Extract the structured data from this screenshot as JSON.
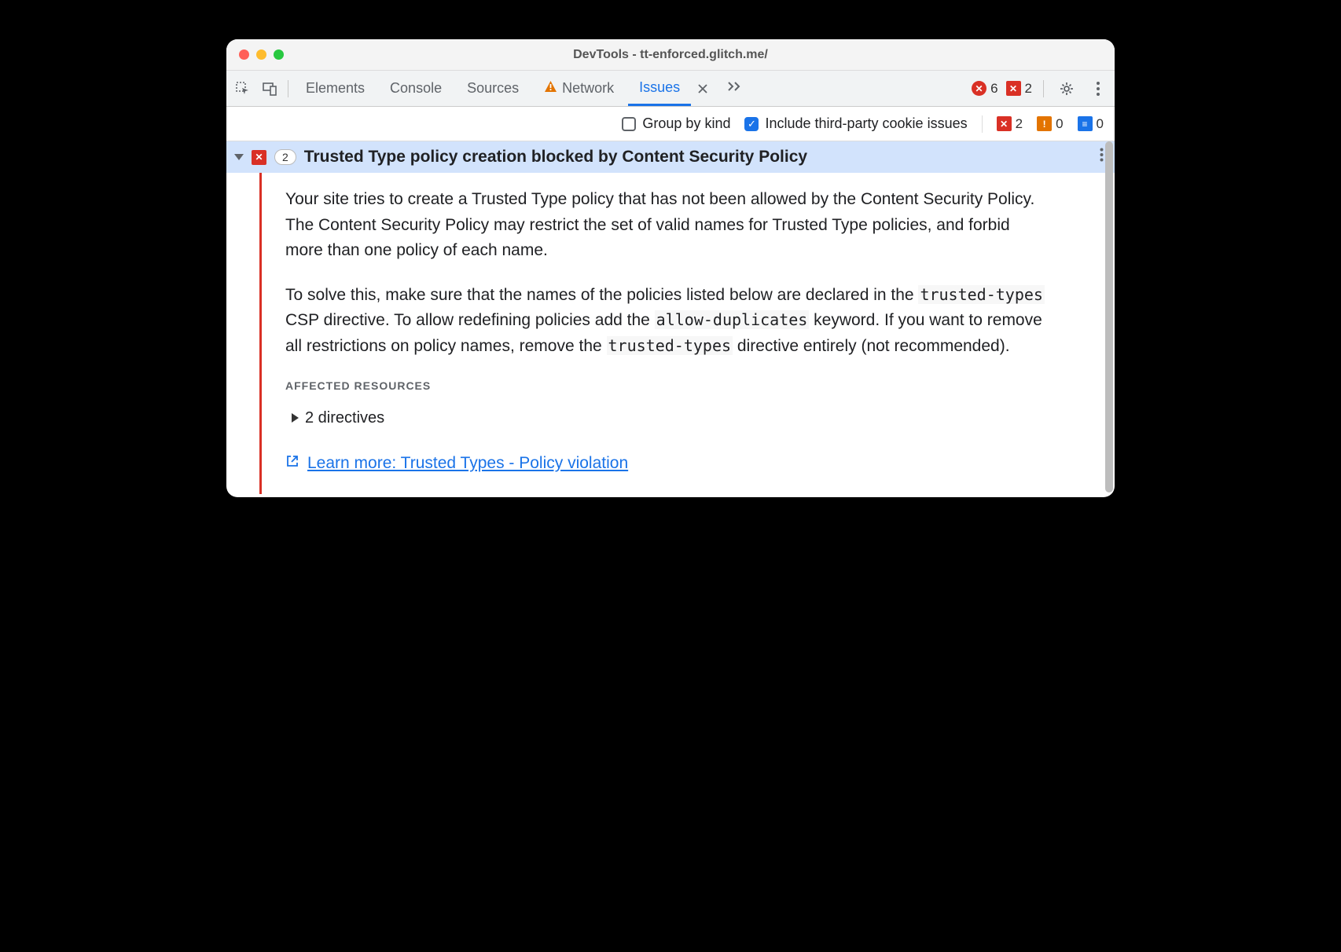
{
  "window": {
    "title": "DevTools - tt-enforced.glitch.me/"
  },
  "tabs": {
    "elements": "Elements",
    "console": "Console",
    "sources": "Sources",
    "network": "Network",
    "issues": "Issues"
  },
  "counts": {
    "errors_top": "6",
    "issues_top": "2",
    "toolbar_err": "2",
    "toolbar_warn": "0",
    "toolbar_info": "0"
  },
  "toolbar": {
    "group_label": "Group by kind",
    "third_party_label": "Include third-party cookie issues"
  },
  "issue": {
    "count": "2",
    "title": "Trusted Type policy creation blocked by Content Security Policy",
    "p1": "Your site tries to create a Trusted Type policy that has not been allowed by the Content Security Policy. The Content Security Policy may restrict the set of valid names for Trusted Type policies, and forbid more than one policy of each name.",
    "p2a": "To solve this, make sure that the names of the policies listed below are declared in the ",
    "code1": "trusted-types",
    "p2b": " CSP directive. To allow redefining policies add the ",
    "code2": "allow-duplicates",
    "p2c": " keyword. If you want to remove all restrictions on policy names, remove the ",
    "code3": "trusted-types",
    "p2d": " directive entirely (not recommended).",
    "affected_label": "AFFECTED RESOURCES",
    "directives": "2 directives",
    "learn_more": "Learn more: Trusted Types - Policy violation"
  }
}
